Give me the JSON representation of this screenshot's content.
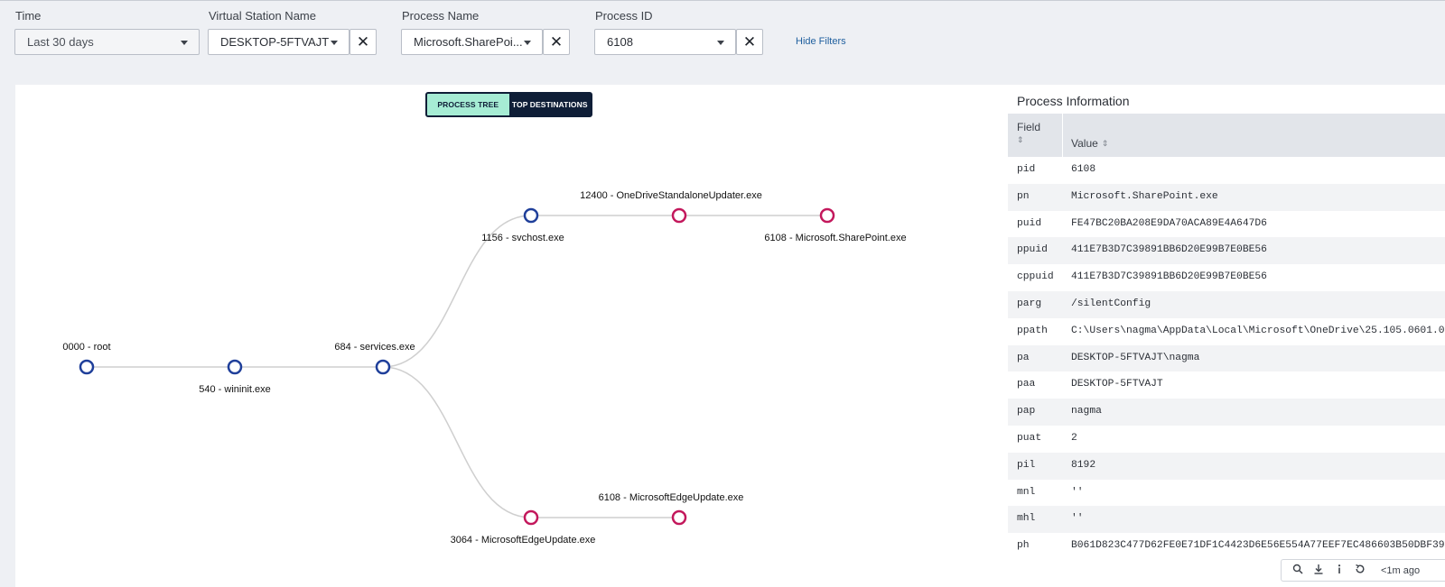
{
  "filters": {
    "time": {
      "label": "Time",
      "value": "Last 30 days"
    },
    "station": {
      "label": "Virtual Station Name",
      "value": "DESKTOP-5FTVAJT"
    },
    "process_name": {
      "label": "Process Name",
      "value": "Microsoft.SharePoi..."
    },
    "process_id": {
      "label": "Process ID",
      "value": "6108"
    },
    "clear_glyph": "✕",
    "hide_filters": "Hide Filters"
  },
  "toggle": {
    "process_tree": "PROCESS TREE",
    "top_destinations": "TOP DESTINATIONS"
  },
  "tree": {
    "nodes": [
      {
        "id": "root",
        "label": "0000 - root",
        "kind": "blue"
      },
      {
        "id": "wininit",
        "label": "540 - wininit.exe",
        "kind": "blue"
      },
      {
        "id": "services",
        "label": "684 - services.exe",
        "kind": "blue"
      },
      {
        "id": "svchost",
        "label": "1156 - svchost.exe",
        "kind": "blue"
      },
      {
        "id": "onedrive",
        "label": "12400 - OneDriveStandaloneUpdater.exe",
        "kind": "pink"
      },
      {
        "id": "sharepoint",
        "label": "6108 - Microsoft.SharePoint.exe",
        "kind": "pink"
      },
      {
        "id": "edge3064",
        "label": "3064 - MicrosoftEdgeUpdate.exe",
        "kind": "pink"
      },
      {
        "id": "edge6108",
        "label": "6108 - MicrosoftEdgeUpdate.exe",
        "kind": "pink"
      }
    ],
    "colors": {
      "blue": "#1f3f9a",
      "pink": "#c3185c",
      "edge": "#cfcfcf"
    }
  },
  "info": {
    "title": "Process Information",
    "col_field": "Field",
    "col_value": "Value",
    "sort_glyph": "⇕",
    "rows": [
      {
        "k": "pid",
        "v": "6108"
      },
      {
        "k": "pn",
        "v": "Microsoft.SharePoint.exe"
      },
      {
        "k": "puid",
        "v": "FE47BC20BA208E9DA70ACA89E4A647D6"
      },
      {
        "k": "ppuid",
        "v": "411E7B3D7C39891BB6D20E99B7E0BE56"
      },
      {
        "k": "cppuid",
        "v": "411E7B3D7C39891BB6D20E99B7E0BE56"
      },
      {
        "k": "parg",
        "v": "/silentConfig"
      },
      {
        "k": "ppath",
        "v": "C:\\Users\\nagma\\AppData\\Local\\Microsoft\\OneDrive\\25.105.0601.0"
      },
      {
        "k": "pa",
        "v": "DESKTOP-5FTVAJT\\nagma"
      },
      {
        "k": "paa",
        "v": "DESKTOP-5FTVAJT"
      },
      {
        "k": "pap",
        "v": "nagma"
      },
      {
        "k": "puat",
        "v": "2"
      },
      {
        "k": "pil",
        "v": "8192"
      },
      {
        "k": "mnl",
        "v": "''"
      },
      {
        "k": "mhl",
        "v": "''"
      },
      {
        "k": "ph",
        "v": "B061D823C477D62FE0E71DF1C4423D6E56E554A77EEF7EC486603B50DBF39"
      }
    ]
  },
  "footer": {
    "status": "<1m ago"
  }
}
